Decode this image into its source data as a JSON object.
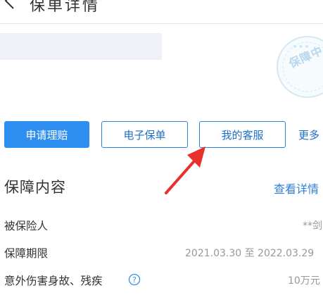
{
  "header": {
    "title": "保单详情"
  },
  "stamp": {
    "text": "保障中"
  },
  "actions": {
    "claim": "申请理赔",
    "epolicy": "电子保单",
    "service": "我的客服",
    "more": "更多"
  },
  "coverage": {
    "title": "保障内容",
    "view_detail": "查看详情",
    "rows": [
      {
        "label": "被保险人",
        "value": "**剑"
      },
      {
        "label": "保障期限",
        "value": "2021.03.30 至 2022.03.29"
      },
      {
        "label": "意外伤害身故、残疾",
        "value": "10万元"
      }
    ]
  },
  "colors": {
    "accent": "#2f8ff0",
    "link": "#2f7fd6",
    "annotation_arrow": "#e8302c"
  },
  "icons": [
    "back-arrow-icon",
    "coverage-stamp",
    "help-icon",
    "annotation-arrow"
  ]
}
